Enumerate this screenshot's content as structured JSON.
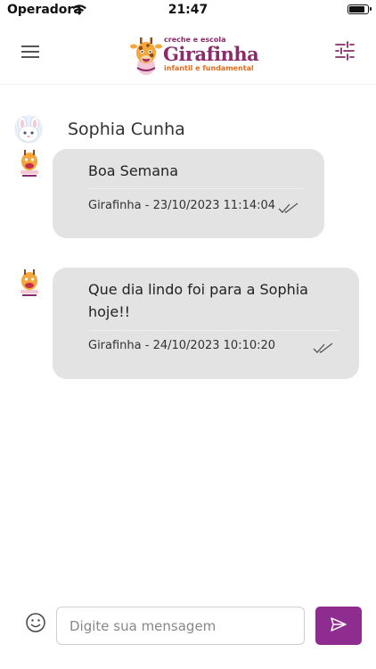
{
  "status_bar": {
    "carrier": "Operadora",
    "time": "21:47",
    "battery_level": 0.9
  },
  "header": {
    "menu_icon": "hamburger-menu-icon",
    "filter_icon": "sliders-filter-icon",
    "logo": {
      "top_text": "creche e escola",
      "name": "Girafinha",
      "sub_text": "infantil e fundamental"
    }
  },
  "conversation": {
    "contact_name": "Sophia Cunha",
    "messages": [
      {
        "text": "Boa Semana",
        "meta": "Girafinha - 23/10/2023 11:14:04",
        "status_icon": "double-check-icon"
      },
      {
        "text": "Que dia lindo foi para a Sophia hoje!!",
        "meta": "Girafinha - 24/10/2023 10:10:20",
        "status_icon": "double-check-icon"
      }
    ]
  },
  "composer": {
    "emoji_icon": "smiley-icon",
    "placeholder": "Digite sua mensagem",
    "value": "",
    "send_icon": "send-arrow-icon"
  },
  "colors": {
    "brand": "#8a2b6b",
    "bubble": "#e3e3e3",
    "send_button": "#8e2d8f",
    "accent_orange": "#e56b1f"
  }
}
